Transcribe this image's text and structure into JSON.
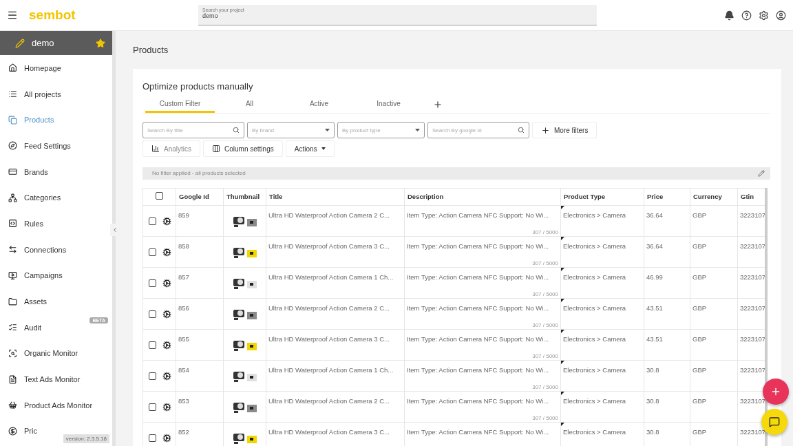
{
  "header": {
    "logo": "sembot",
    "search": {
      "label": "Search your project",
      "value": "demo"
    }
  },
  "sidebar": {
    "project": {
      "name": "demo",
      "favorite": true
    },
    "items": [
      {
        "label": "Homepage",
        "selected": false
      },
      {
        "label": "All projects",
        "selected": false
      },
      {
        "label": "Products",
        "selected": true
      },
      {
        "label": "Feed Settings",
        "selected": false
      },
      {
        "label": "Brands",
        "selected": false
      },
      {
        "label": "Categories",
        "selected": false
      },
      {
        "label": "Rules",
        "selected": false
      },
      {
        "label": "Connections",
        "selected": false
      },
      {
        "label": "Campaigns",
        "selected": false
      },
      {
        "label": "Assets",
        "selected": false
      },
      {
        "label": "Audit",
        "selected": false,
        "badge": "BETA"
      },
      {
        "label": "Organic Monitor",
        "selected": false
      },
      {
        "label": "Text Ads Monitor",
        "selected": false
      },
      {
        "label": "Product Ads Monitor",
        "selected": false
      },
      {
        "label": "Pric",
        "selected": false
      }
    ],
    "version": "version: 2.3.5.18"
  },
  "page_title": "Products",
  "panel": {
    "title": "Optimize products manually",
    "tabs": [
      {
        "label": "Custom Filter",
        "selected": true
      },
      {
        "label": "All",
        "selected": false
      },
      {
        "label": "Active",
        "selected": false
      },
      {
        "label": "Inactive",
        "selected": false
      }
    ],
    "filters": [
      {
        "kind": "search",
        "placeholder": "Search By title"
      },
      {
        "kind": "select",
        "placeholder": "By brand"
      },
      {
        "kind": "select",
        "placeholder": "By product type"
      },
      {
        "kind": "search",
        "placeholder": "Search By google id"
      }
    ],
    "more_filters": "More filters",
    "toolbar": [
      {
        "label": "Analytics",
        "disabled": true
      },
      {
        "label": "Column settings",
        "disabled": false
      },
      {
        "label": "Actions",
        "disabled": false
      }
    ],
    "filter_status": "No filter applied - all products selected",
    "table": {
      "all_checked": false,
      "columns": [
        "Google Id",
        "Thumbnail",
        "Title",
        "Description",
        "Product Type",
        "Price",
        "Currency",
        "Gtin"
      ],
      "rows": [
        {
          "checked": false,
          "id": "859",
          "thumbnail": {
            "color": "#8a8a8a"
          },
          "title": "Ultra HD Waterproof Action Camera 2 C...",
          "description": "Item Type: Action Camera NFC Support: No Wi...",
          "counter": "307 / 5000",
          "product_type": "Electronics > Camera",
          "price": "36.64",
          "currency": "GBP",
          "gtin": "3223107"
        },
        {
          "checked": false,
          "id": "858",
          "thumbnail": {
            "color": "#f2d600"
          },
          "title": "Ultra HD Waterproof Action Camera 3 C...",
          "description": "Item Type: Action Camera NFC Support: No Wi...",
          "counter": "307 / 5000",
          "product_type": "Electronics > Camera",
          "price": "36.64",
          "currency": "GBP",
          "gtin": "3223107"
        },
        {
          "checked": false,
          "id": "857",
          "thumbnail": {
            "color": "#e0e0e0"
          },
          "title": "Ultra HD Waterproof Action Camera 1 Ch...",
          "description": "Item Type: Action Camera NFC Support: No Wi...",
          "counter": "307 / 5000",
          "product_type": "Electronics > Camera",
          "price": "46.99",
          "currency": "GBP",
          "gtin": "3223107"
        },
        {
          "checked": false,
          "id": "856",
          "thumbnail": {
            "color": "#8a8a8a"
          },
          "title": "Ultra HD Waterproof Action Camera 2 C...",
          "description": "Item Type: Action Camera NFC Support: No Wi...",
          "counter": "307 / 5000",
          "product_type": "Electronics > Camera",
          "price": "43.51",
          "currency": "GBP",
          "gtin": "3223107"
        },
        {
          "checked": false,
          "id": "855",
          "thumbnail": {
            "color": "#f2d600"
          },
          "title": "Ultra HD Waterproof Action Camera 3 C...",
          "description": "Item Type: Action Camera NFC Support: No Wi...",
          "counter": "307 / 5000",
          "product_type": "Electronics > Camera",
          "price": "43.51",
          "currency": "GBP",
          "gtin": "3223107"
        },
        {
          "checked": false,
          "id": "854",
          "thumbnail": {
            "color": "#e0e0e0"
          },
          "title": "Ultra HD Waterproof Action Camera 1 Ch...",
          "description": "Item Type: Action Camera NFC Support: No Wi...",
          "counter": "307 / 5000",
          "product_type": "Electronics > Camera",
          "price": "30.8",
          "currency": "GBP",
          "gtin": "3223107"
        },
        {
          "checked": false,
          "id": "853",
          "thumbnail": {
            "color": "#8a8a8a"
          },
          "title": "Ultra HD Waterproof Action Camera 2 C...",
          "description": "Item Type: Action Camera NFC Support: No Wi...",
          "counter": "307 / 5000",
          "product_type": "Electronics > Camera",
          "price": "30.8",
          "currency": "GBP",
          "gtin": "3223107"
        },
        {
          "checked": false,
          "id": "852",
          "thumbnail": {
            "color": "#f2d600"
          },
          "title": "Ultra HD Waterproof Action Camera 3 C...",
          "description": "Item Type: Action Camera NFC Support: No Wi...",
          "product_type": "Electronics > Camera",
          "price": "30.8",
          "currency": "GBP",
          "gtin": "3223107"
        }
      ]
    }
  }
}
